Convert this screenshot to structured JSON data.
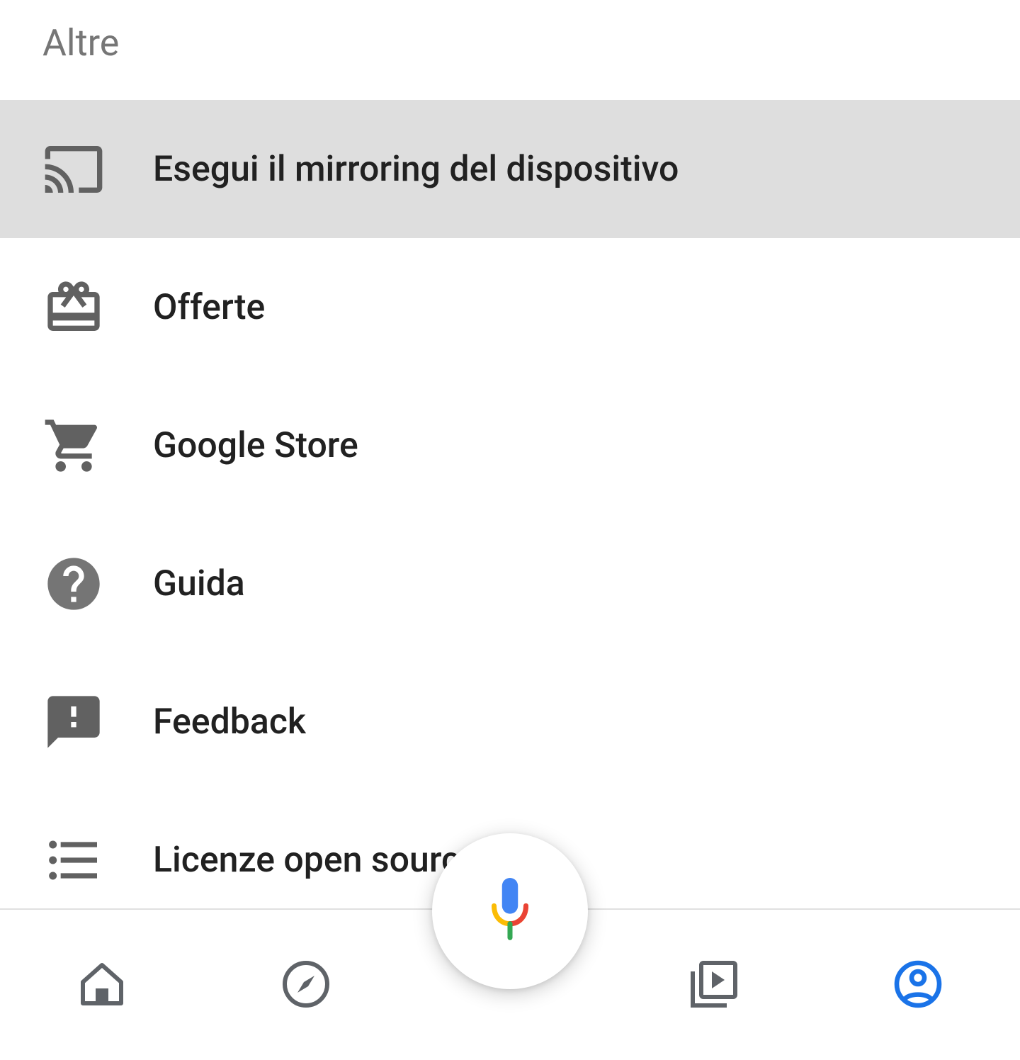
{
  "header": {
    "title": "Altre"
  },
  "menu": {
    "items": [
      {
        "label": "Esegui il mirroring del dispositivo",
        "icon": "cast-icon",
        "highlighted": true
      },
      {
        "label": "Offerte",
        "icon": "gift-icon",
        "highlighted": false
      },
      {
        "label": "Google Store",
        "icon": "cart-icon",
        "highlighted": false
      },
      {
        "label": "Guida",
        "icon": "help-icon",
        "highlighted": false
      },
      {
        "label": "Feedback",
        "icon": "feedback-icon",
        "highlighted": false
      },
      {
        "label": "Licenze open source",
        "icon": "list-icon",
        "highlighted": false
      }
    ]
  },
  "bottomNav": {
    "items": [
      {
        "name": "home",
        "active": false
      },
      {
        "name": "explore",
        "active": false
      },
      {
        "name": "media",
        "active": false
      },
      {
        "name": "account",
        "active": true
      }
    ]
  }
}
